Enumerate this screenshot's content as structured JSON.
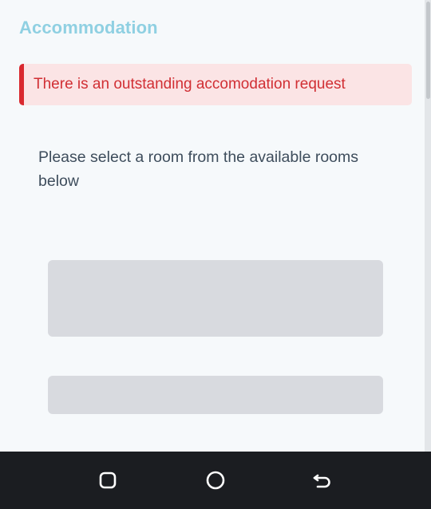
{
  "page": {
    "title": "Accommodation"
  },
  "alert": {
    "message": "There is an outstanding accomodation request",
    "color": "#d12f34",
    "background": "#fbe4e5"
  },
  "content": {
    "instructions": "Please select a room from the available rooms below"
  },
  "navbar": {
    "icons": [
      "recent-apps-icon",
      "home-icon",
      "back-icon"
    ]
  },
  "colors": {
    "title": "#8fd0e2",
    "placeholder": "#d8dadf",
    "navbar": "#1b1d21"
  }
}
